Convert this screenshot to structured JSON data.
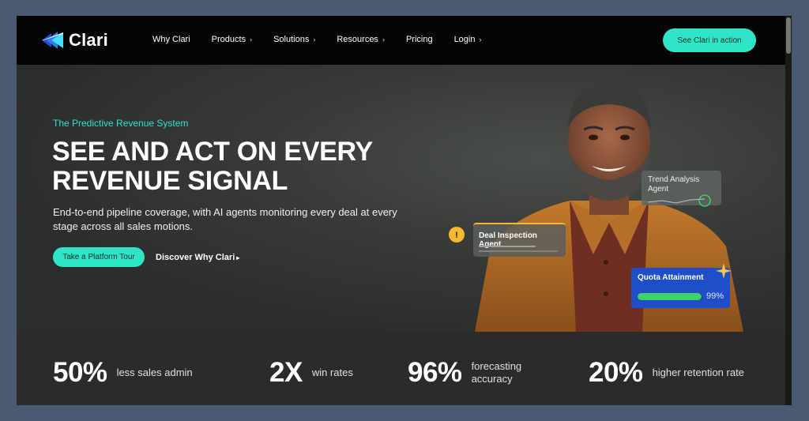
{
  "brand": {
    "name": "Clari",
    "accent": "#2ee6c7"
  },
  "nav": {
    "items": [
      {
        "label": "Why Clari",
        "has_chevron": false
      },
      {
        "label": "Products",
        "has_chevron": true
      },
      {
        "label": "Solutions",
        "has_chevron": true
      },
      {
        "label": "Resources",
        "has_chevron": true
      },
      {
        "label": "Pricing",
        "has_chevron": false
      },
      {
        "label": "Login",
        "has_chevron": true
      }
    ],
    "chevron": "›",
    "cta": "See Clari in action"
  },
  "hero": {
    "eyebrow": "The Predictive Revenue System",
    "headline_line1": "SEE AND ACT ON EVERY",
    "headline_line2": "REVENUE SIGNAL",
    "subtext": "End-to-end pipeline coverage, with AI agents monitoring every deal at every stage across all sales motions.",
    "primary_button": "Take a Platform Tour",
    "secondary_link": "Discover Why Clari",
    "secondary_arrow": "▸"
  },
  "cards": {
    "trend": "Trend Analysis Agent",
    "deal": "Deal Inspection Agent",
    "warning_glyph": "!",
    "quota_title": "Quota Attainment",
    "quota_value": 0.99,
    "quota_label": "99%"
  },
  "stats": [
    {
      "value": "50%",
      "label": "less sales admin"
    },
    {
      "value": "2X",
      "label": "win rates"
    },
    {
      "value": "96%",
      "label": "forecasting accuracy"
    },
    {
      "value": "20%",
      "label": "higher retention rate"
    }
  ]
}
